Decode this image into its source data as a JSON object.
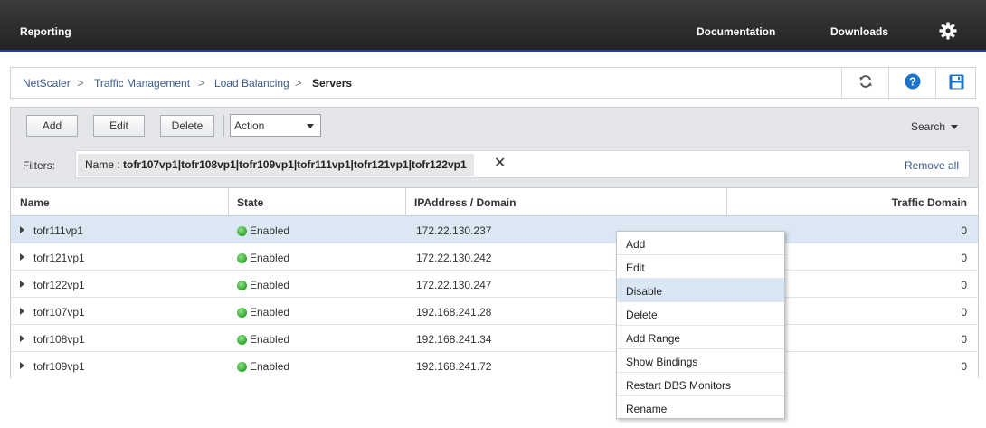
{
  "topbar": {
    "brand": "Reporting",
    "documentation": "Documentation",
    "downloads": "Downloads"
  },
  "breadcrumb": {
    "items": [
      "NetScaler",
      "Traffic Management",
      "Load Balancing"
    ],
    "current": "Servers",
    "separator": ">"
  },
  "toolbar": {
    "add_label": "Add",
    "edit_label": "Edit",
    "delete_label": "Delete",
    "action_label": "Action",
    "search_label": "Search"
  },
  "filters": {
    "label": "Filters:",
    "chip_key": "Name :",
    "chip_value": "tofr107vp1|tofr108vp1|tofr109vp1|tofr111vp1|tofr121vp1|tofr122vp1",
    "close_glyph": "✕",
    "remove_all": "Remove all"
  },
  "table": {
    "columns": [
      "Name",
      "State",
      "IPAddress / Domain",
      "Traffic Domain"
    ],
    "rows": [
      {
        "name": "tofr111vp1",
        "state": "Enabled",
        "ip": "172.22.130.237",
        "td": "0"
      },
      {
        "name": "tofr121vp1",
        "state": "Enabled",
        "ip": "172.22.130.242",
        "td": "0"
      },
      {
        "name": "tofr122vp1",
        "state": "Enabled",
        "ip": "172.22.130.247",
        "td": "0"
      },
      {
        "name": "tofr107vp1",
        "state": "Enabled",
        "ip": "192.168.241.28",
        "td": "0"
      },
      {
        "name": "tofr108vp1",
        "state": "Enabled",
        "ip": "192.168.241.34",
        "td": "0"
      },
      {
        "name": "tofr109vp1",
        "state": "Enabled",
        "ip": "192.168.241.72",
        "td": "0"
      }
    ]
  },
  "context_menu": {
    "items": [
      "Add",
      "Edit",
      "Disable",
      "Delete",
      "Add Range",
      "Show Bindings",
      "Restart DBS Monitors",
      "Rename"
    ]
  },
  "colors": {
    "topbar_accent": "#2b3f8f",
    "link": "#3b5b8a",
    "status_enabled": "#2ea62a",
    "selected_row": "#dbe8f4",
    "icon_blue": "#1a73c8"
  },
  "icons": {
    "gear": "gear-icon",
    "refresh": "refresh-icon",
    "help": "help-icon",
    "save": "save-icon"
  }
}
